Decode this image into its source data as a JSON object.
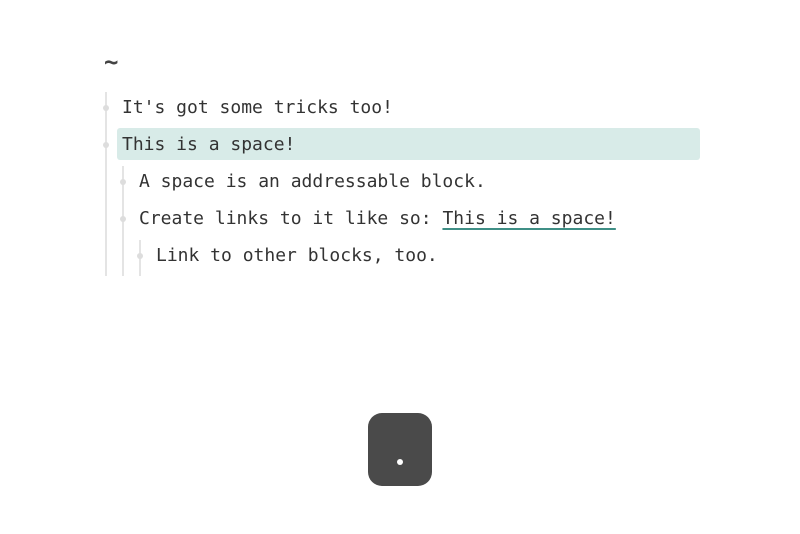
{
  "header": {
    "title": "~"
  },
  "blocks": [
    {
      "text": "It's got some tricks too!"
    },
    {
      "text": "This is a space!"
    },
    {
      "text": "A space is an addressable block."
    },
    {
      "text": "Create links to it like so: ",
      "link": "This is a space!"
    },
    {
      "text": "Link to other blocks, too."
    }
  ],
  "key_overlay": {
    "key": "."
  },
  "colors": {
    "highlight": "#d8ebe8",
    "link_underline": "#3f8f86",
    "key_bg": "#4a4a4a"
  }
}
